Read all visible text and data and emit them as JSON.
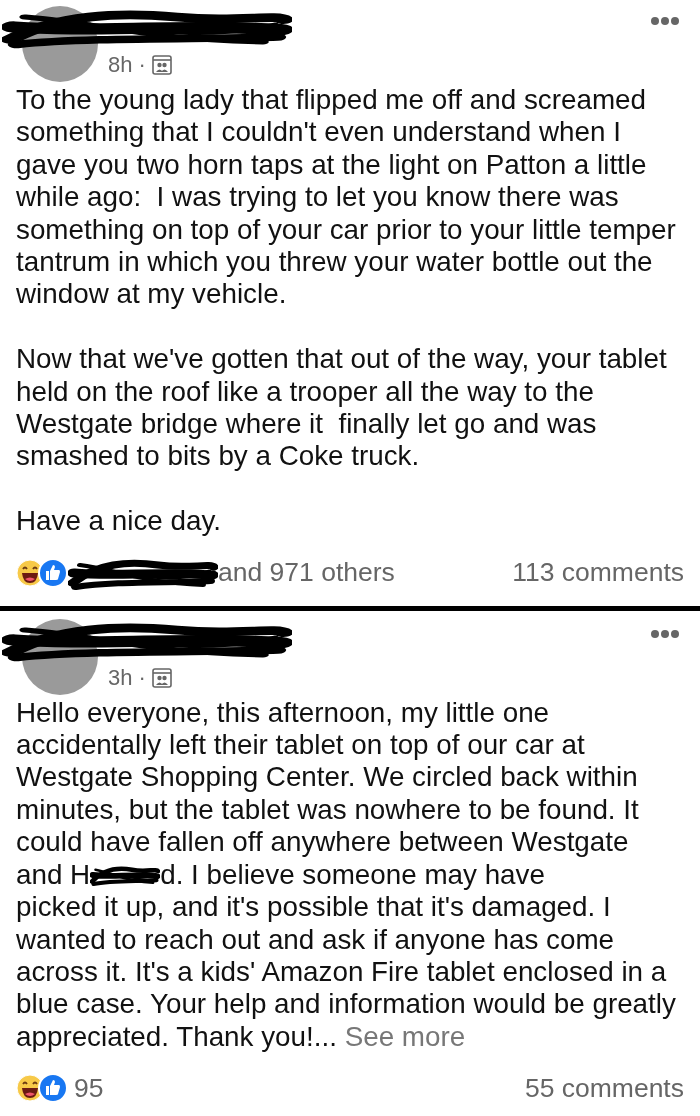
{
  "posts": [
    {
      "author_redacted": true,
      "time": "8h ·",
      "paragraphs": [
        [
          {
            "kind": "text",
            "text": "To the young lady that flipped me off and screamed something that I couldn't even understand when I gave you two horn taps at the light on Patton a little while ago:  I was trying to let you know there was something on top of your car prior to your little temper tantrum in which you threw your water bottle out the window at my vehicle."
          }
        ],
        [
          {
            "kind": "text",
            "text": "Now that we've gotten that out of the way, your tablet held on the roof like a trooper all the way to the Westgate bridge where it  finally let go and was smashed to bits by a Coke truck."
          }
        ],
        [
          {
            "kind": "text",
            "text": "Have a nice day."
          }
        ]
      ],
      "reactions": {
        "name_redacted": true,
        "count": "and 971 others"
      },
      "comments": "113 comments"
    },
    {
      "author_redacted": true,
      "time": "3h ·",
      "paragraphs": [
        [
          {
            "kind": "text",
            "text": "Hello everyone, this afternoon, my little one accidentally left their tablet on top of our car at Westgate Shopping Center. We circled back within minutes, but the tablet was nowhere to be found. It could have fallen off anywhere between Westgate"
          },
          {
            "kind": "redacted_line",
            "before": "and H",
            "after": "d. I believe someone may have"
          },
          {
            "kind": "text",
            "text": "picked it up, and it's possible that it's damaged. I wanted to reach out and ask if anyone has come across it. It's a kids' Amazon Fire tablet enclosed in a blue case. Your help and information would be greatly appreciated. Thank you!...",
            "more": "See more"
          }
        ]
      ],
      "reactions": {
        "name_redacted": false,
        "count": "95"
      },
      "comments": "55 comments"
    }
  ]
}
